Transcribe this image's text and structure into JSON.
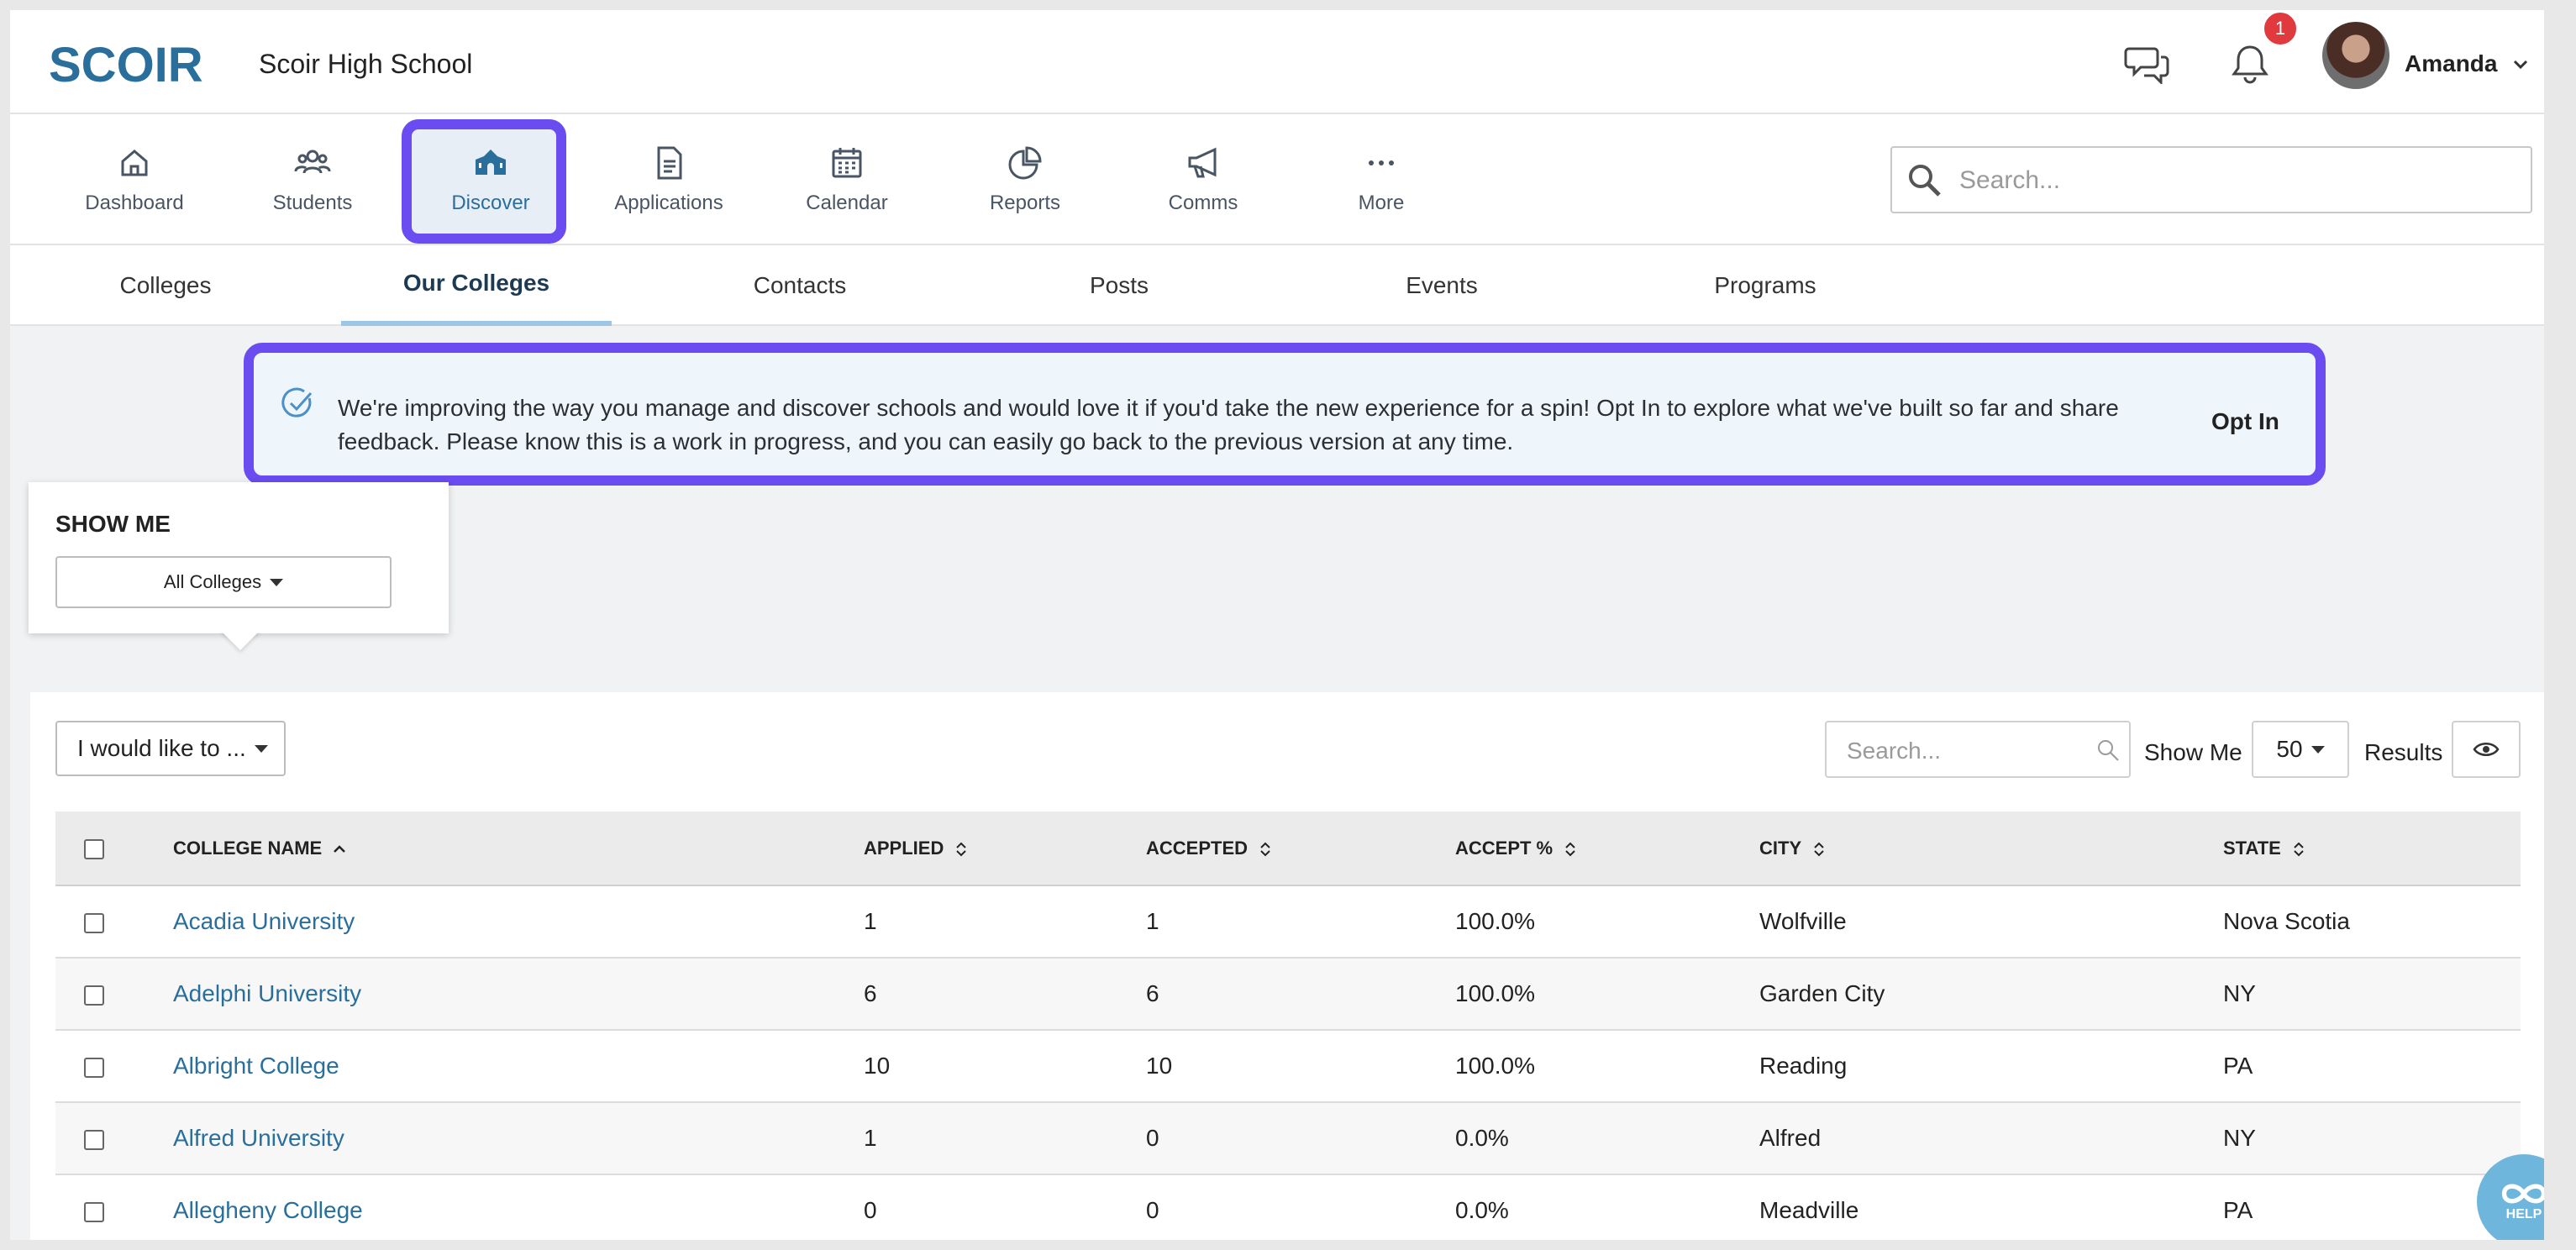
{
  "header": {
    "logo_text": "SCOIR",
    "school_name": "Scoir High School",
    "notification_count": "1",
    "user_name": "Amanda"
  },
  "nav": {
    "items": [
      {
        "label": "Dashboard",
        "icon": "home-icon"
      },
      {
        "label": "Students",
        "icon": "users-icon"
      },
      {
        "label": "Discover",
        "icon": "school-icon",
        "active": true
      },
      {
        "label": "Applications",
        "icon": "document-icon"
      },
      {
        "label": "Calendar",
        "icon": "calendar-icon"
      },
      {
        "label": "Reports",
        "icon": "pie-chart-icon"
      },
      {
        "label": "Comms",
        "icon": "megaphone-icon"
      },
      {
        "label": "More",
        "icon": "more-dots-icon"
      }
    ],
    "search_placeholder": "Search..."
  },
  "subtabs": {
    "items": [
      "Colleges",
      "Our Colleges",
      "Contacts",
      "Posts",
      "Events",
      "Programs"
    ],
    "active": "Our Colleges"
  },
  "banner": {
    "text": "We're improving the way you manage and discover schools and would love it if you'd take the new experience for a spin! Opt In to explore what we've built so far and share feedback. Please know this is a work in progress, and you can easily go back to the previous version at any time.",
    "action_label": "Opt In"
  },
  "show_me_panel": {
    "title": "SHOW ME",
    "selected": "All Colleges"
  },
  "toolbar": {
    "action_select": "I would like to ...",
    "search_placeholder": "Search...",
    "show_me_label": "Show Me",
    "page_size": "50",
    "results_label": "Results"
  },
  "table": {
    "columns": [
      "COLLEGE NAME",
      "APPLIED",
      "ACCEPTED",
      "ACCEPT %",
      "CITY",
      "STATE"
    ],
    "rows": [
      [
        "Acadia University",
        "1",
        "1",
        "100.0%",
        "Wolfville",
        "Nova Scotia"
      ],
      [
        "Adelphi University",
        "6",
        "6",
        "100.0%",
        "Garden City",
        "NY"
      ],
      [
        "Albright College",
        "10",
        "10",
        "100.0%",
        "Reading",
        "PA"
      ],
      [
        "Alfred University",
        "1",
        "0",
        "0.0%",
        "Alfred",
        "NY"
      ],
      [
        "Allegheny College",
        "0",
        "0",
        "0.0%",
        "Meadville",
        "PA"
      ]
    ]
  },
  "help": {
    "label": "HELP"
  },
  "colors": {
    "brand": "#2a6e9c",
    "highlight": "#6a4cf0",
    "badge": "#e0393e",
    "help_button": "#6fb6dd"
  }
}
